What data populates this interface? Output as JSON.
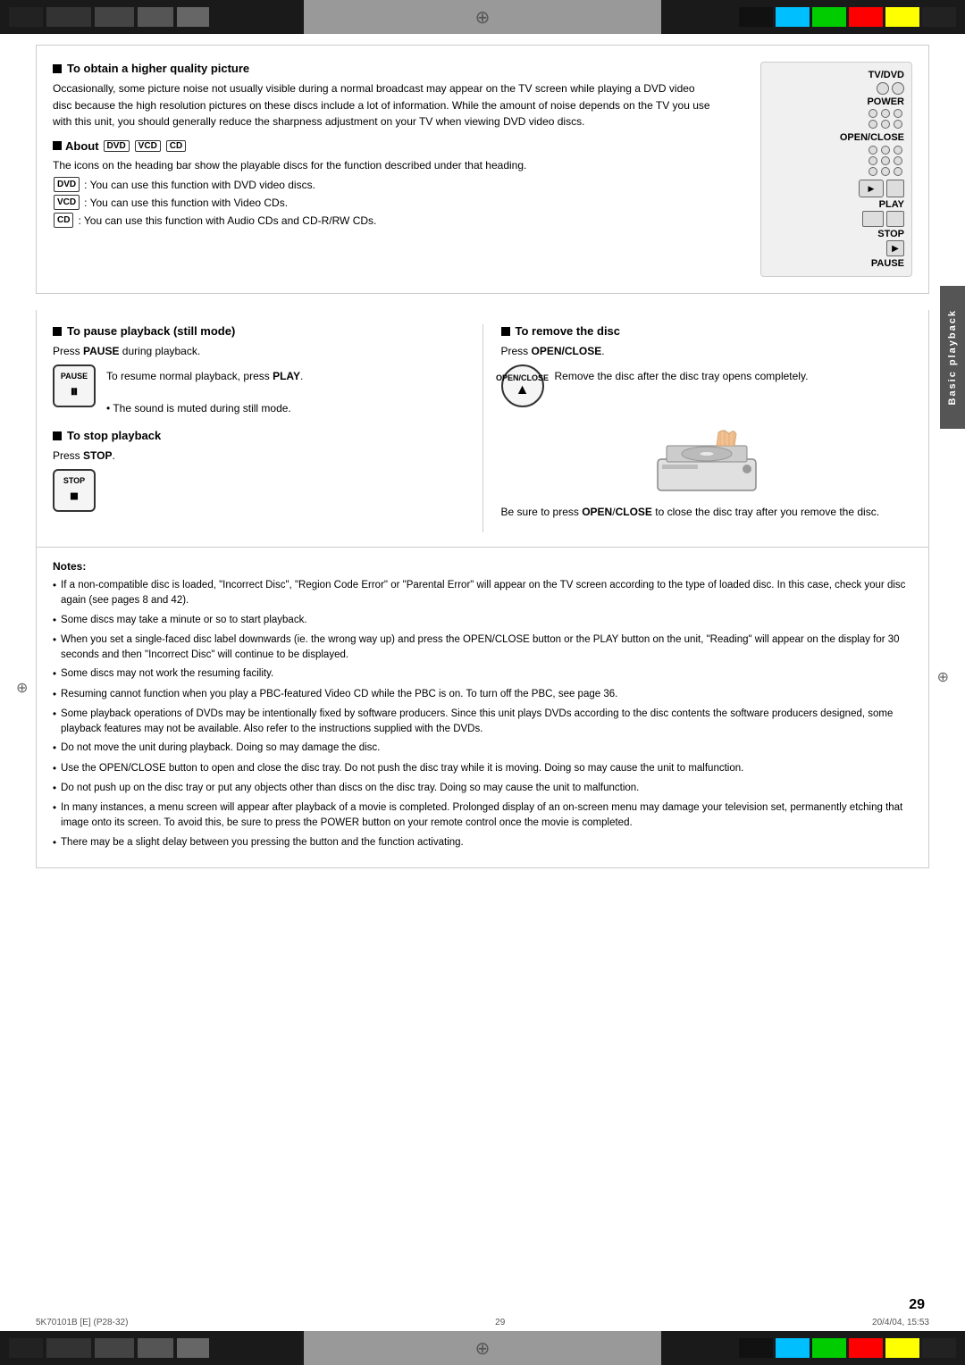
{
  "page": {
    "number": "29",
    "footer_left": "5K70101B [E] (P28-32)",
    "footer_center": "29",
    "footer_right": "20/4/04, 15:53"
  },
  "sidebar": {
    "label": "Basic playback"
  },
  "top_section": {
    "higher_quality": {
      "heading": "To obtain a higher quality picture",
      "body": "Occasionally, some picture noise not usually visible during a normal broadcast may appear on the TV screen while playing a DVD video disc because the high resolution pictures on these discs include a lot of information. While the amount of noise depends on the TV you use with this unit, you should generally reduce the sharpness adjustment on your TV when viewing DVD video discs."
    },
    "about": {
      "heading": "About",
      "intro": "The icons on the heading bar show the playable discs for the function described under that heading.",
      "items": [
        ": You can use this function with DVD video discs.",
        ": You can use this function with Video CDs.",
        ": You can use this function with Audio CDs and CD-R/RW CDs."
      ],
      "badges": [
        "DVD",
        "VCD",
        "CD"
      ]
    },
    "remote": {
      "labels": [
        "TV/DVD",
        "POWER",
        "OPEN/CLOSE",
        "PLAY",
        "STOP",
        "PAUSE"
      ]
    }
  },
  "middle_section": {
    "pause": {
      "heading": "To pause playback (still mode)",
      "instruction": "Press PAUSE during playback.",
      "button_label": "PAUSE",
      "button_symbol": "⏸",
      "desc_line1": "To resume normal playback, press",
      "desc_play": "PLAY",
      "desc_line2": "• The sound is muted during still mode."
    },
    "stop": {
      "heading": "To stop playback",
      "instruction": "Press STOP.",
      "button_label": "STOP",
      "button_symbol": "⏹"
    },
    "remove": {
      "heading": "To remove the disc",
      "instruction": "Press OPEN/CLOSE.",
      "button_label": "OPEN/CLOSE",
      "button_symbol": "▲",
      "desc": "Remove the disc after the disc tray opens completely."
    },
    "close_note": "Be sure to press OPEN/CLOSE to close the disc tray after you remove the disc."
  },
  "notes": {
    "heading": "Notes:",
    "items": [
      "If a non-compatible disc is loaded, \"Incorrect Disc\", \"Region Code Error\" or \"Parental Error\" will appear on the TV screen according to the type of loaded disc. In this case, check your disc again (see pages 8 and 42).",
      "Some discs may take a minute or so to start playback.",
      "When you set a single-faced disc label downwards (ie. the wrong way up) and press the OPEN/CLOSE button or the PLAY button on the unit, \"Reading\" will appear on the display for 30 seconds and then \"Incorrect Disc\" will continue to be displayed.",
      "Some discs may not work the resuming facility.",
      "Resuming cannot function when you play a PBC-featured Video CD while the PBC is on. To turn off the PBC, see page 36.",
      "Some playback operations of DVDs may be intentionally fixed by software producers. Since this unit plays DVDs according to the disc contents the software producers designed, some playback features may not be available. Also refer to the instructions supplied with the DVDs.",
      "Do not move the unit during playback. Doing so may damage the disc.",
      "Use the OPEN/CLOSE button to open and close the disc tray. Do not push the disc tray while it is moving. Doing so may cause the unit to malfunction.",
      "Do not push up on the disc tray or put any objects other than discs on the disc tray. Doing so may cause the unit to malfunction.",
      "In many instances, a menu screen will appear after playback of a movie is completed. Prolonged display of an on-screen menu may damage your television set, permanently etching that image onto its screen. To avoid this, be sure to press the POWER button on your remote control once the movie is completed.",
      "There may be a slight delay between you pressing the button and the function activating."
    ]
  }
}
